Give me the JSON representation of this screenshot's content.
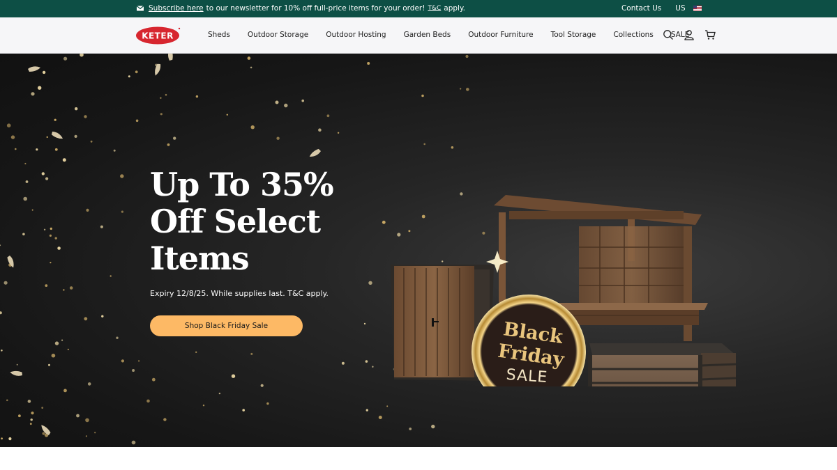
{
  "announcement": {
    "subscribe_link": "Subscribe here",
    "message": "to our newsletter for 10% off full-price items for your order!",
    "tc_link": "T&C",
    "tc_suffix": "apply.",
    "contact": "Contact Us",
    "region": "US",
    "bg_color": "#0d4f45"
  },
  "header": {
    "logo_text": "KETER",
    "logo_color": "#d7262f",
    "nav": [
      "Sheds",
      "Outdoor Storage",
      "Outdoor Hosting",
      "Garden Beds",
      "Outdoor Furniture",
      "Tool Storage",
      "Collections",
      "SALE"
    ],
    "icons": [
      "search-icon",
      "account-icon",
      "cart-icon"
    ]
  },
  "hero": {
    "headline": "Up To 35% Off Select Items",
    "expiry": "Expiry 12/8/25. While supplies last. T&C apply.",
    "cta_label": "Shop Black Friday Sale",
    "cta_color": "#fdb965",
    "badge": {
      "line1": "Black",
      "line2": "Friday",
      "line3": "SALE"
    }
  }
}
